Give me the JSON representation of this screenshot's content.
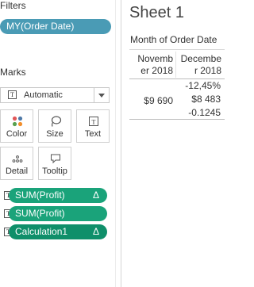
{
  "filters": {
    "title": "Filters",
    "pills": [
      {
        "label": "MY(Order Date)"
      }
    ]
  },
  "marks": {
    "title": "Marks",
    "mark_type": "Automatic",
    "buttons": [
      {
        "label": "Color",
        "icon": "color-dots-icon"
      },
      {
        "label": "Size",
        "icon": "size-lasso-icon"
      },
      {
        "label": "Text",
        "icon": "text-box-icon"
      },
      {
        "label": "Detail",
        "icon": "detail-dots-icon"
      },
      {
        "label": "Tooltip",
        "icon": "tooltip-bubble-icon"
      }
    ],
    "fields": [
      {
        "label": "SUM(Profit)",
        "delta": "Δ",
        "type_icon": "text-icon"
      },
      {
        "label": "SUM(Profit)",
        "delta": "",
        "type_icon": "text-icon"
      },
      {
        "label": "Calculation1",
        "delta": "Δ",
        "type_icon": "text-icon"
      }
    ]
  },
  "sheet": {
    "title": "Sheet 1",
    "column_header": "Month of Order Date",
    "columns": [
      {
        "line1": "Novemb",
        "line2": "er 2018"
      },
      {
        "line1": "Decembe",
        "line2": "r 2018"
      }
    ],
    "cells": {
      "dec_pct": "-12,45%",
      "nov_value": "$9 690",
      "dec_value": "$8 483",
      "dec_calc": "-0.1245"
    }
  },
  "colors": {
    "filter_pill": "#4a9bb5",
    "measure_pill": "#1aa37a",
    "measure_pill_dark": "#0f8f6a"
  }
}
